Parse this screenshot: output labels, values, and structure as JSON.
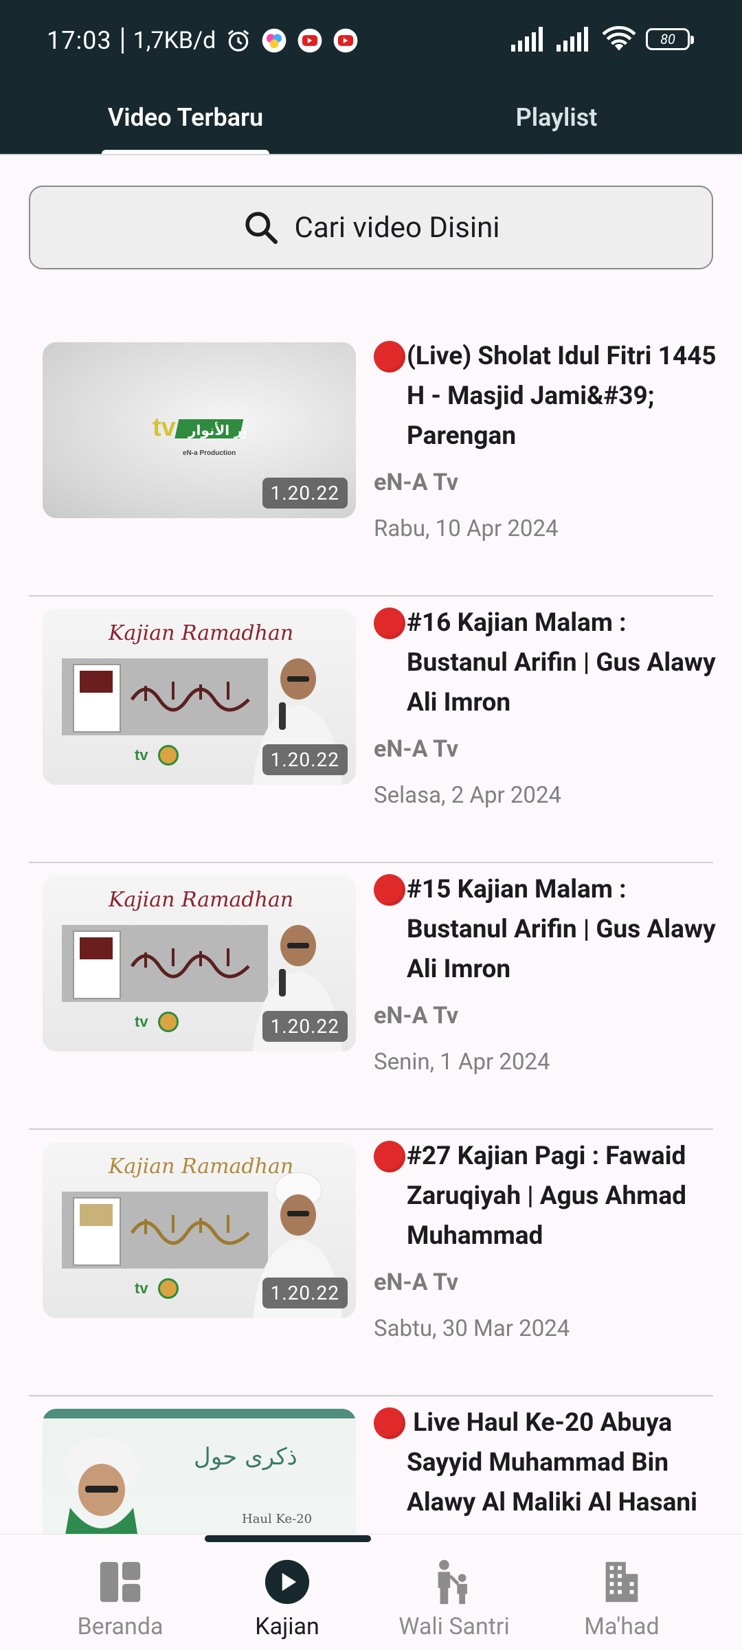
{
  "status_bar": {
    "time": "17:03",
    "network_speed": "1,7KB/d",
    "battery": "80",
    "icons": [
      "alarm-icon",
      "app-icon",
      "youtube-icon",
      "youtube-icon",
      "signal-icon",
      "signal-icon",
      "wifi-icon",
      "battery-icon"
    ]
  },
  "tabs": [
    {
      "label": "Video Terbaru",
      "active": true
    },
    {
      "label": "Playlist",
      "active": false
    }
  ],
  "search": {
    "placeholder": "Cari video Disini"
  },
  "videos": [
    {
      "title": "(Live) Sholat Idul Fitri 1445 H - Masjid Jami&#39; Parengan",
      "channel": "eN-A Tv",
      "date": "Rabu, 10 Apr 2024",
      "duration": "1.20.22",
      "thumbnail": "tv-logo"
    },
    {
      "title": "#16 Kajian Malam : Bustanul Arifin | Gus Alawy Ali Imron",
      "channel": "eN-A Tv",
      "date": "Selasa, 2 Apr 2024",
      "duration": "1.20.22",
      "thumbnail": "kajian-ramadhan"
    },
    {
      "title": "#15 Kajian Malam : Bustanul Arifin | Gus Alawy Ali Imron",
      "channel": "eN-A Tv",
      "date": "Senin, 1 Apr 2024",
      "duration": "1.20.22",
      "thumbnail": "kajian-ramadhan"
    },
    {
      "title": "#27 Kajian Pagi : Fawaid Zaruqiyah | Agus Ahmad Muhammad",
      "channel": "eN-A Tv",
      "date": "Sabtu, 30 Mar 2024",
      "duration": "1.20.22",
      "thumbnail": "kajian-ramadhan-gold"
    },
    {
      "title": " Live Haul Ke-20 Abuya Sayyid Muhammad Bin Alawy Al Maliki Al Hasani",
      "channel": "",
      "date": "",
      "duration": "",
      "thumbnail": "haul"
    }
  ],
  "thumbnail_text": {
    "tv_logo_sub": "eN-a Production",
    "kajian_script": "Kajian Ramadhan",
    "haul_label": "Haul Ke-20"
  },
  "bottom_nav": [
    {
      "label": "Beranda",
      "icon": "dashboard-icon",
      "active": false
    },
    {
      "label": "Kajian",
      "icon": "play-circle-icon",
      "active": true
    },
    {
      "label": "Wali Santri",
      "icon": "parent-child-icon",
      "active": false
    },
    {
      "label": "Ma'had",
      "icon": "building-icon",
      "active": false
    }
  ],
  "colors": {
    "header": "#17292f",
    "live": "#e02a2a",
    "accent": "#17292f"
  }
}
